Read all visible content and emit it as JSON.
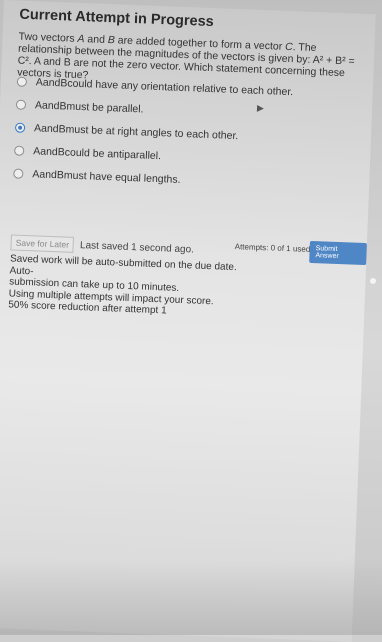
{
  "header": {
    "title": "Current Attempt in Progress"
  },
  "question": {
    "prefix": "Two vectors ",
    "vec_a": "A",
    "and": " and ",
    "vec_b": "B",
    "text1": " are added together to form a vector ",
    "vec_c": "C",
    "text2": ". The relationship between the magnitudes of the vectors is given by: A",
    "text3": "² + B² = C². A and B are not the zero vector. Which statement concerning these vectors is true?"
  },
  "options": [
    {
      "a": "A",
      "and": " and ",
      "b": "B",
      "rest": " could have any orientation relative to each other.",
      "selected": false
    },
    {
      "a": "A",
      "and": " and ",
      "b": "B",
      "rest": " must be parallel.",
      "selected": false
    },
    {
      "a": "A",
      "and": " and ",
      "b": "B",
      "rest": " must be at right angles to each other.",
      "selected": true
    },
    {
      "a": "A",
      "and": " and ",
      "b": "B",
      "rest": " could be antiparallel.",
      "selected": false
    },
    {
      "a": "A",
      "and": " and ",
      "b": "B",
      "rest": " must have equal lengths.",
      "selected": false
    }
  ],
  "footer": {
    "save_label": "Save for Later",
    "last_saved": "Last saved 1 second ago.",
    "info_lines": [
      "Saved work will be auto-submitted on the due date. Auto-",
      "submission can take up to 10 minutes.",
      "Using multiple attempts will impact your score.",
      "50% score reduction after attempt 1"
    ],
    "attempts": "Attempts: 0 of 1 used",
    "submit_label": "Submit Answer"
  },
  "colors": {
    "accent": "#3b78c9",
    "submit_bg": "#4f86c6"
  }
}
